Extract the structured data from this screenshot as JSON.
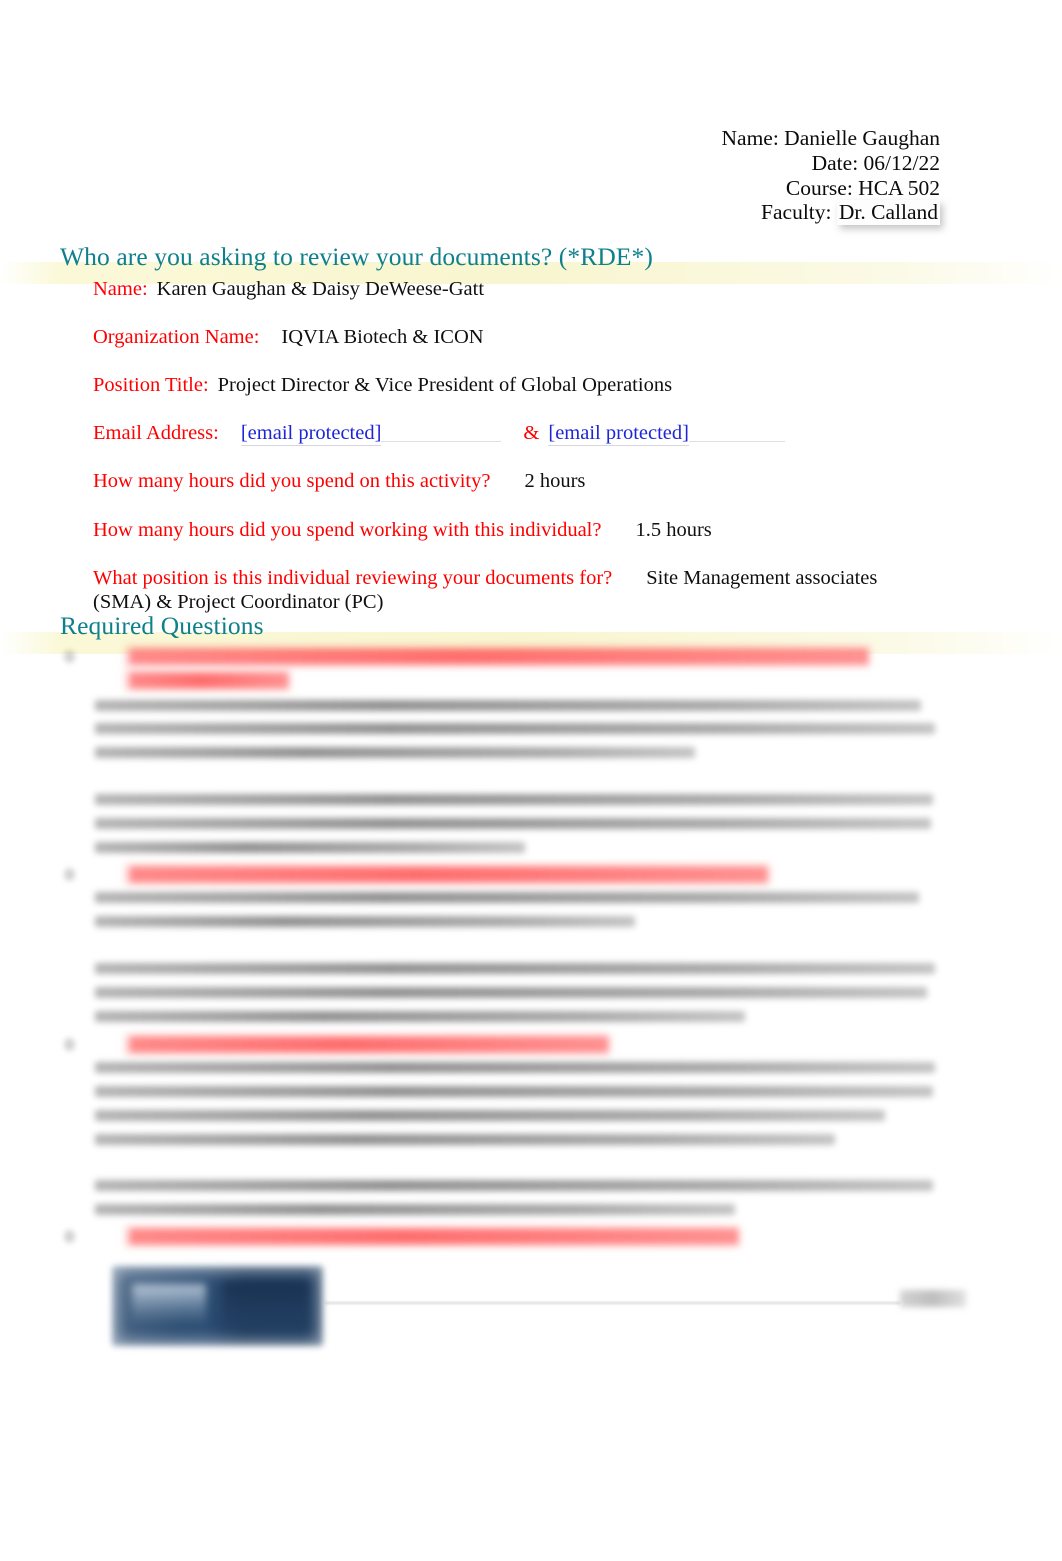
{
  "header": {
    "name_line": "Name: Danielle Gaughan",
    "date_line": "Date: 06/12/22",
    "course_line": "Course: HCA 502",
    "faculty_label": "Faculty: ",
    "faculty_value": "Dr. Calland"
  },
  "section_rde": {
    "heading": "Who are you asking to review your documents? (*RDE*)",
    "fields": [
      {
        "label": "Name:",
        "value": "Karen Gaughan & Daisy DeWeese-Gatt"
      },
      {
        "label": "Organization Name:",
        "value": "IQVIA Biotech & ICON"
      },
      {
        "label": "Position Title:",
        "value": "Project Director & Vice President of Global Operations"
      },
      {
        "label": "Email Address:",
        "value": "[email protected]",
        "value2": "[email protected]",
        "conjunction": "&"
      },
      {
        "label": "How many hours did you spend on this activity?",
        "value": "2 hours"
      },
      {
        "label": "How many hours did you spend working with this individual?",
        "value": "1.5 hours"
      },
      {
        "label": "What position is this individual reviewing your documents for?",
        "value": "Site Management associates",
        "value_wrap": "(SMA) & Project Coordinator (PC)"
      }
    ]
  },
  "section_required": {
    "heading": "Required Questions",
    "note": "Question text and answers are blurred/redacted in the source document.",
    "items": [
      {
        "number": "1",
        "question_redacted": true,
        "question_lines": 2,
        "answer_paragraphs": [
          3,
          3
        ]
      },
      {
        "number": "2",
        "question_redacted": true,
        "question_lines": 1,
        "answer_paragraphs": [
          3,
          3
        ]
      },
      {
        "number": "3",
        "question_redacted": true,
        "question_lines": 1,
        "answer_paragraphs": [
          4,
          2
        ]
      },
      {
        "number": "4",
        "question_redacted": true,
        "question_lines": 1,
        "answer_paragraphs": []
      }
    ]
  },
  "footer": {
    "logo_label": "institution-logo",
    "page_number_redacted": true
  },
  "colors": {
    "heading_teal": "#0d8089",
    "label_red": "#ff0000",
    "link_blue": "#1d26d6",
    "highlight_yellow": "#f8f5cd",
    "logo_navy": "#28496e",
    "body_black": "#101010"
  }
}
